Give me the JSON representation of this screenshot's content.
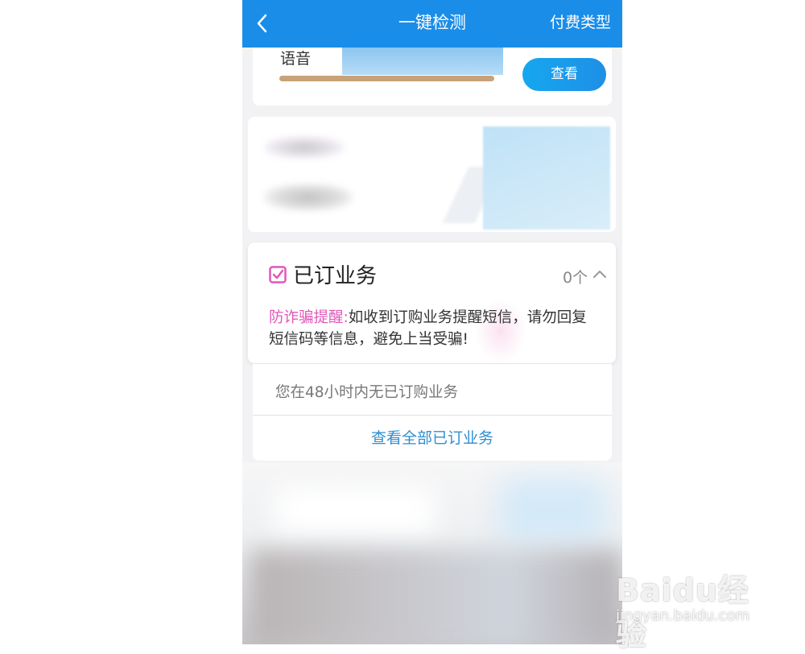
{
  "header": {
    "title": "一键检测",
    "right_label": "付费类型"
  },
  "voice_card": {
    "label": "语音",
    "button": "查看"
  },
  "subscribed": {
    "title": "已订业务",
    "count": "0个",
    "warning_label": "防诈骗提醒:",
    "warning_text": "如收到订购业务提醒短信，请勿回复短信码等信息，避免上当受骗!",
    "empty_text": "您在48小时内无已订购业务",
    "view_all": "查看全部已订业务"
  },
  "watermark": {
    "logo": "Baidu经验",
    "url": "jingyan.baidu.com"
  },
  "colors": {
    "header_bg": "#1a8de8",
    "accent_pink": "#e257b8",
    "link_blue": "#2f8ed1"
  }
}
